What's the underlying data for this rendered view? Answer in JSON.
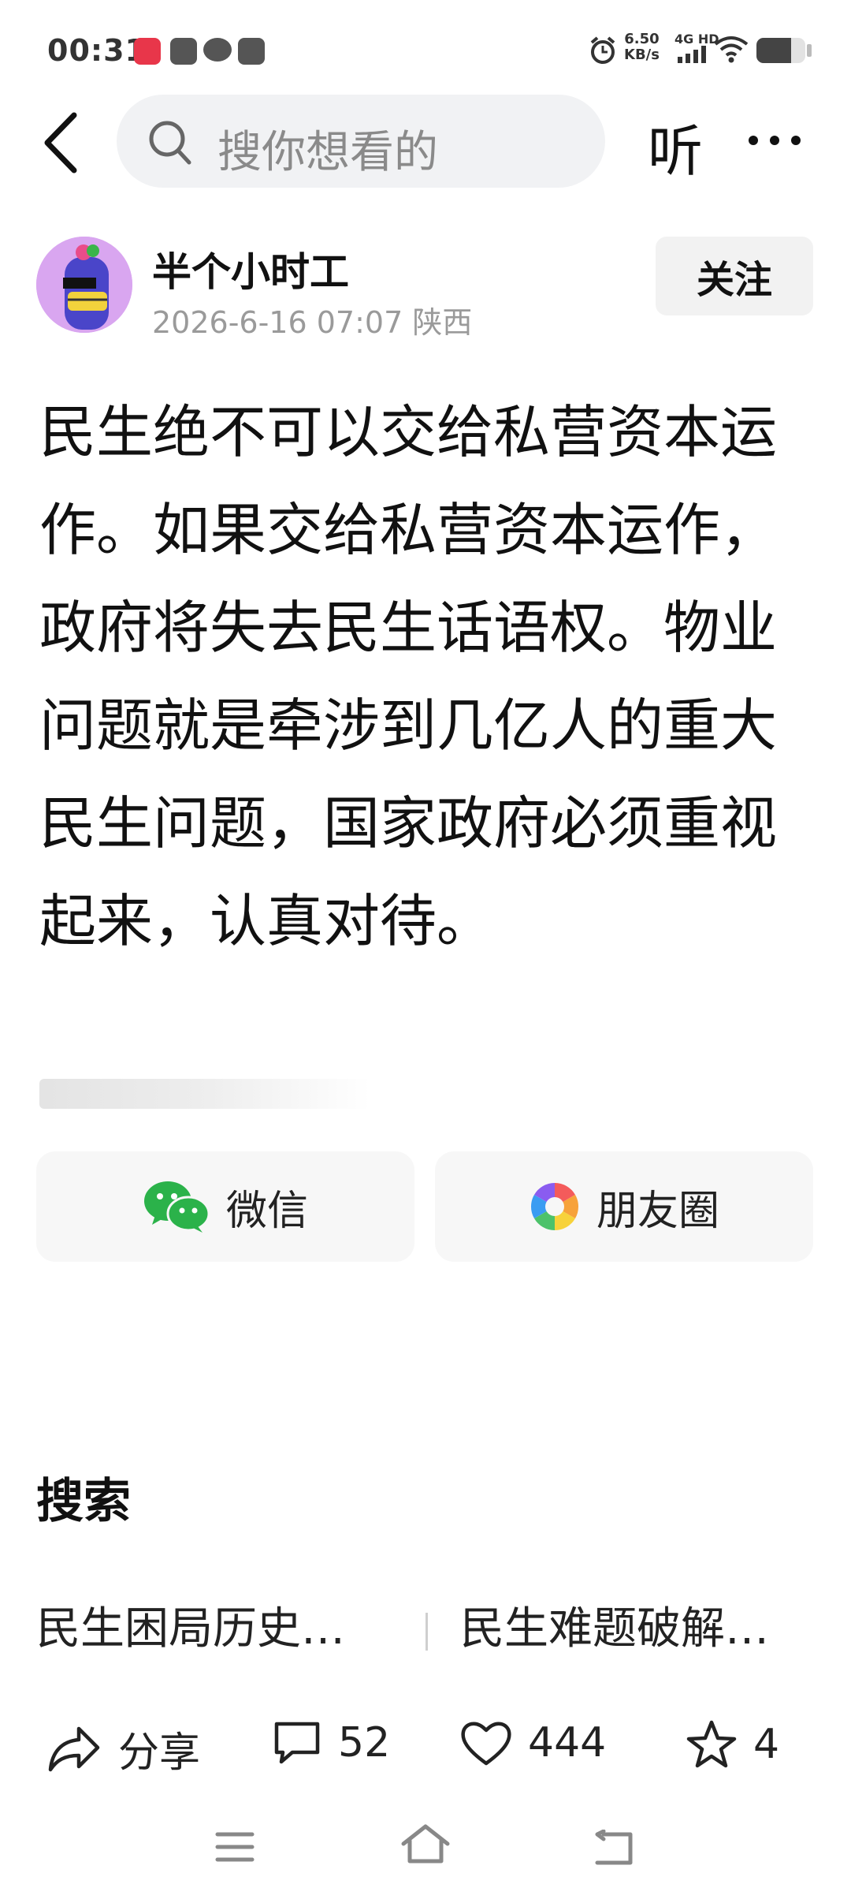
{
  "status_bar": {
    "time": "00:31",
    "speed_value": "6.50",
    "speed_unit": "KB/s",
    "network": "4G HD"
  },
  "nav": {
    "search_placeholder": "搜你想看的",
    "listen_label": "听"
  },
  "author": {
    "name": "半个小时工",
    "meta": "2026-6-16 07:07 陕西",
    "follow_label": "关注"
  },
  "post": {
    "text": "民生绝不可以交给私营资本运作。如果交给私营资本运作，政府将失去民生话语权。物业问题就是牵涉到几亿人的重大民生问题，国家政府必须重视起来，认真对待。"
  },
  "share": {
    "wechat_label": "微信",
    "moments_label": "朋友圈"
  },
  "search_section": {
    "title": "搜索",
    "suggestions": [
      "民生困局历史…",
      "民生难题破解…"
    ]
  },
  "actions": {
    "share_label": "分享",
    "comments_count": "52",
    "likes_count": "444",
    "favorites_count": "4"
  }
}
